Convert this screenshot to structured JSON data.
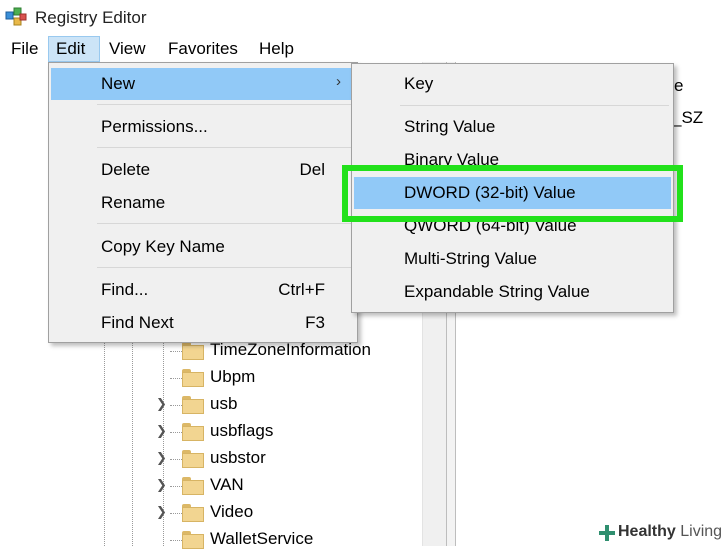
{
  "window": {
    "title": "Registry Editor",
    "icon": "registry-editor-icon"
  },
  "menubar": {
    "items": [
      {
        "label": "File"
      },
      {
        "label": "Edit",
        "active": true
      },
      {
        "label": "View"
      },
      {
        "label": "Favorites"
      },
      {
        "label": "Help"
      }
    ]
  },
  "edit_menu": {
    "items": [
      {
        "label": "New",
        "arrow": "›"
      },
      {
        "label": "Permissions..."
      },
      {
        "label": "Delete",
        "shortcut": "Del"
      },
      {
        "label": "Rename"
      },
      {
        "label": "Copy Key Name"
      },
      {
        "label": "Find...",
        "shortcut": "Ctrl+F"
      },
      {
        "label": "Find Next",
        "shortcut": "F3"
      }
    ]
  },
  "new_submenu": {
    "items": [
      {
        "label": "Key"
      },
      {
        "label": "String Value"
      },
      {
        "label": "Binary Value"
      },
      {
        "label": "DWORD (32-bit) Value",
        "highlighted": true
      },
      {
        "label": "QWORD (64-bit) Value"
      },
      {
        "label": "Multi-String Value"
      },
      {
        "label": "Expandable String Value"
      }
    ]
  },
  "tree": {
    "items": [
      {
        "label": "TimeZoneInformation",
        "expandable": false
      },
      {
        "label": "Ubpm",
        "expandable": false
      },
      {
        "label": "usb",
        "expandable": true
      },
      {
        "label": "usbflags",
        "expandable": true
      },
      {
        "label": "usbstor",
        "expandable": true
      },
      {
        "label": "VAN",
        "expandable": true
      },
      {
        "label": "Video",
        "expandable": true
      },
      {
        "label": "WalletService",
        "expandable": false
      }
    ]
  },
  "values_pane": {
    "partial_1": "e",
    "partial_2": "_SZ"
  },
  "watermark": {
    "bold": "Healthy",
    "light": " Living"
  },
  "colors": {
    "menu_highlight": "#91c9f7",
    "menubar_active": "#cce4f7",
    "callout_green": "#22e11b",
    "folder": "#f2d591"
  }
}
